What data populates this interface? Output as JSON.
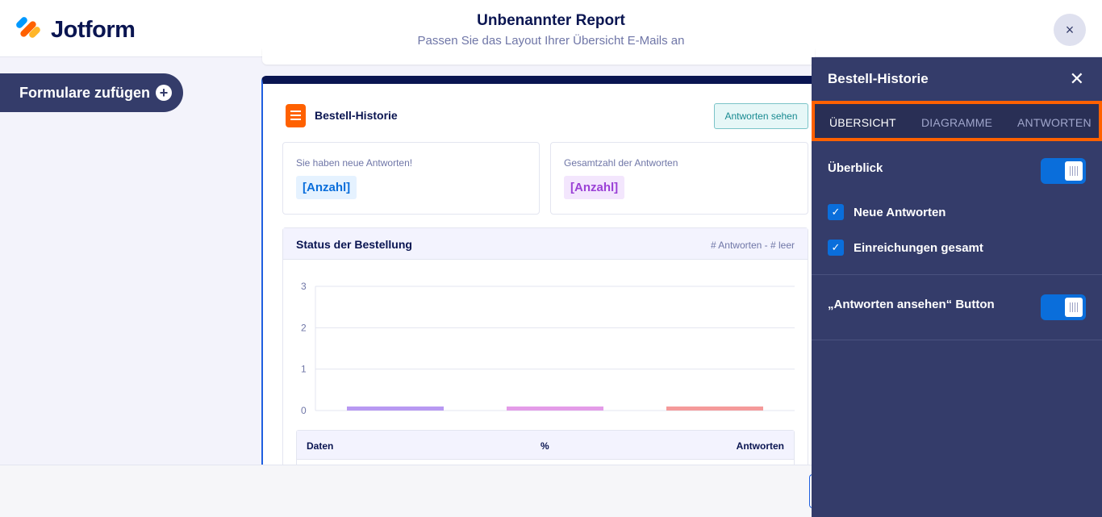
{
  "header": {
    "logo_text": "Jotform",
    "title": "Unbenannter Report",
    "subtitle": "Passen Sie das Layout Ihrer Übersicht E-Mails an",
    "close_icon": "×"
  },
  "sidebar": {
    "add_forms_label": "Formulare zufügen",
    "add_icon": "+"
  },
  "report_card": {
    "title": "Bestell-Historie",
    "view_answers_button": "Antworten sehen",
    "stats": [
      {
        "label": "Sie haben neue Antworten!",
        "value": "[Anzahl]"
      },
      {
        "label": "Gesamtzahl der Antworten",
        "value": "[Anzahl]"
      }
    ],
    "chart_section": {
      "title": "Status der Bestellung",
      "meta": "# Antworten - # leer"
    },
    "table": {
      "columns": [
        "Daten",
        "%",
        "Antworten"
      ]
    }
  },
  "chart_data": {
    "type": "bar",
    "categories": [
      "",
      "",
      ""
    ],
    "values": [
      0,
      0,
      0
    ],
    "colors": [
      "#b899f2",
      "#e49ce8",
      "#f59a9a"
    ],
    "yticks": [
      "3",
      "2",
      "1",
      "0"
    ],
    "ylim": [
      0,
      3
    ],
    "grid": true
  },
  "panel": {
    "title": "Bestell-Historie",
    "close_icon": "✕",
    "tabs": [
      {
        "label": "ÜBERSICHT",
        "active": true
      },
      {
        "label": "DIAGRAMME",
        "active": false
      },
      {
        "label": "ANTWORTEN",
        "active": false
      }
    ],
    "overview_label": "Überblick",
    "overview_enabled": true,
    "checkboxes": [
      {
        "label": "Neue Antworten",
        "checked": true
      },
      {
        "label": "Einreichungen gesamt",
        "checked": true
      }
    ],
    "button_section_label": "„Antworten ansehen“ Button",
    "button_enabled": true,
    "check_glyph": "✓"
  },
  "colors": {
    "accent": "#ff6100",
    "panel_bg": "#343c6a",
    "toggle_on": "#0a6edb",
    "card_border": "#1f5fe0"
  }
}
